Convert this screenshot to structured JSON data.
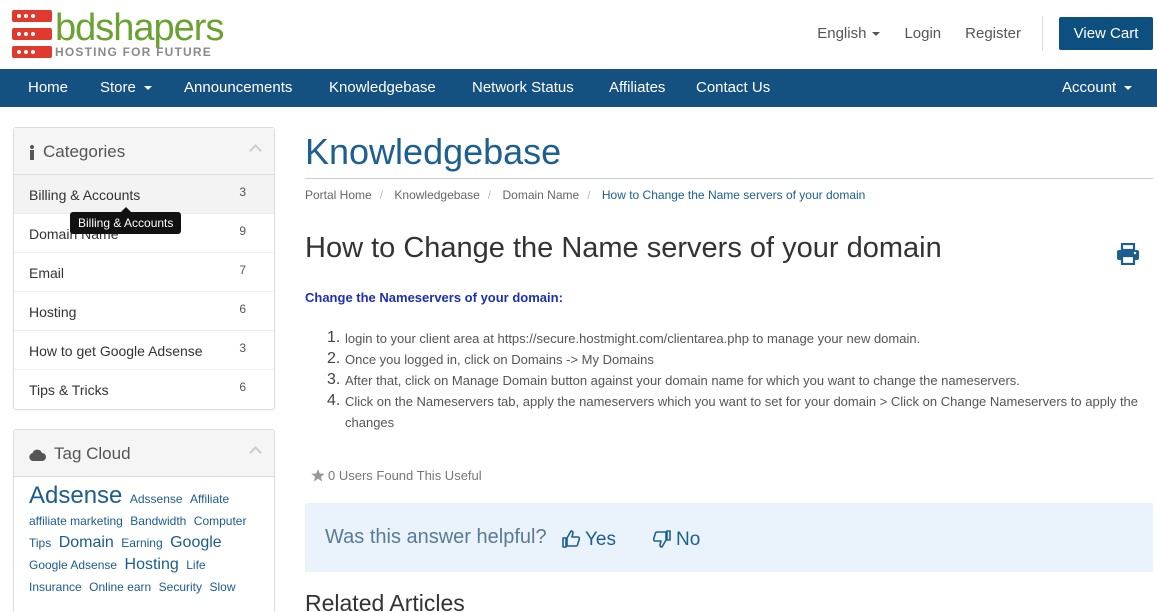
{
  "brand": {
    "name": "bdshapers",
    "tagline": "HOSTING FOR FUTURE"
  },
  "colors": {
    "primary": "#145180",
    "logo_red": "#e03a2f",
    "logo_green": "#6aa232",
    "link": "#1d5f8f"
  },
  "top_links": {
    "language": "English",
    "login": "Login",
    "register": "Register",
    "view_cart": "View Cart"
  },
  "nav": {
    "items": [
      "Home",
      "Store",
      "Announcements",
      "Knowledgebase",
      "Network Status",
      "Affiliates",
      "Contact Us"
    ],
    "account": "Account"
  },
  "categories": {
    "title": "Categories",
    "icon": "info-icon",
    "items": [
      {
        "label": "Billing & Accounts",
        "count": "3"
      },
      {
        "label": "Domain Name",
        "count": "9"
      },
      {
        "label": "Email",
        "count": "7"
      },
      {
        "label": "Hosting",
        "count": "6"
      },
      {
        "label": "How to get Google Adsense",
        "count": "3"
      },
      {
        "label": "Tips & Tricks",
        "count": "6"
      }
    ],
    "tooltip": "Billing & Accounts"
  },
  "tag_cloud": {
    "title": "Tag Cloud",
    "icon": "cloud-icon",
    "tags": [
      "Adsense",
      "Adssense",
      "Affiliate",
      "affiliate marketing",
      "Bandwidth",
      "Computer Tips",
      "Domain",
      "Earning",
      "Google",
      "Google Adsense",
      "Hosting",
      "Life",
      "Insurance",
      "Online earn",
      "Security",
      "Slow"
    ]
  },
  "page": {
    "title": "Knowledgebase",
    "breadcrumb": [
      "Portal Home",
      "Knowledgebase",
      "Domain Name",
      "How to Change the Name servers of your domain"
    ]
  },
  "article": {
    "title": "How to Change the Name servers of your domain",
    "intro": "Change the Nameservers of your domain:",
    "steps": [
      {
        "num": "1.",
        "text": "login to your client area at https://secure.hostmight.com/clientarea.php to manage your new domain."
      },
      {
        "num": "2.",
        "text": "Once you logged in, click on Domains -> My Domains"
      },
      {
        "num": "3.",
        "text": "After that, click on Manage Domain button against your domain name for which you want to change the nameservers."
      },
      {
        "num": "4.",
        "text": "Click on the Nameservers tab, apply the nameservers which you want to set for your domain > Click on Change Nameservers to apply the changes"
      }
    ],
    "useful": "0 Users Found This Useful"
  },
  "feedback": {
    "question": "Was this answer helpful?",
    "yes": "Yes",
    "no": "No"
  },
  "related": {
    "title": "Related Articles"
  }
}
